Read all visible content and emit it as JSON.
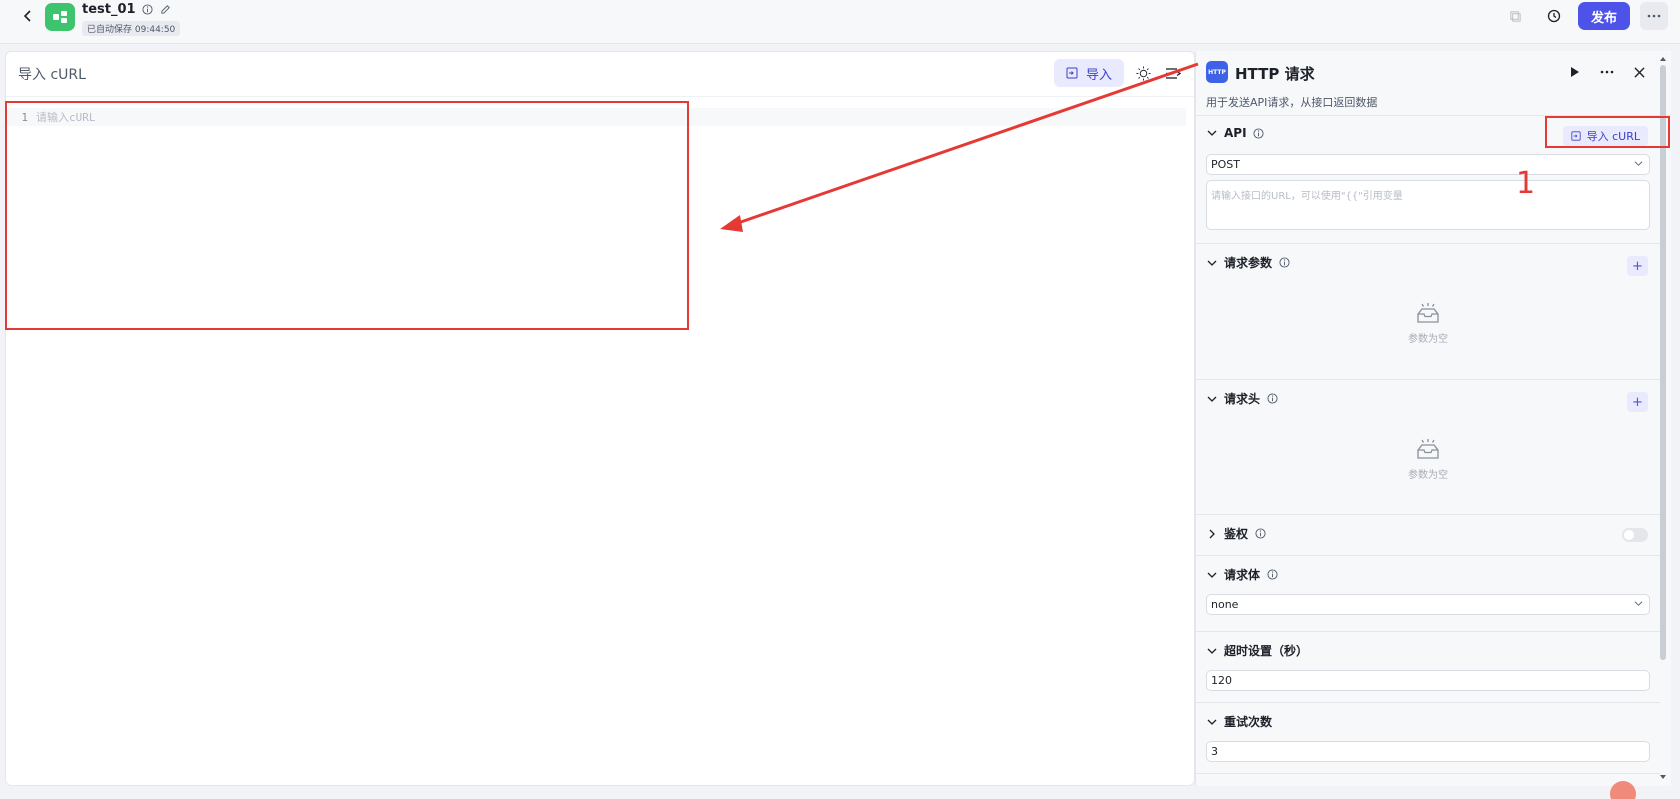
{
  "topbar": {
    "app_title": "test_01",
    "autosave": "已自动保存 09:44:50",
    "publish_label": "发布"
  },
  "editor": {
    "title": "导入 cURL",
    "import_label": "导入",
    "line_number": "1",
    "placeholder": "请输入cURL"
  },
  "http_panel": {
    "logo_text": "HTTP",
    "title": "HTTP 请求",
    "description": "用于发送API请求，从接口返回数据",
    "api": {
      "label": "API",
      "import_curl_label": "导入 cURL",
      "method": "POST",
      "url_placeholder": "请输入接口的URL，可以使用\"{{\"引用变量"
    },
    "params": {
      "label": "请求参数",
      "empty_text": "参数为空"
    },
    "headers": {
      "label": "请求头",
      "empty_text": "参数为空"
    },
    "auth": {
      "label": "鉴权"
    },
    "body": {
      "label": "请求体",
      "value": "none"
    },
    "timeout": {
      "label": "超时设置（秒）",
      "value": "120"
    },
    "retry": {
      "label": "重试次数",
      "value": "3"
    }
  },
  "annotation": {
    "number": "1",
    "color": "#e53935"
  },
  "colors": {
    "accent": "#4d53e8",
    "http_logo": "#3f63e6",
    "app_logo": "#3ec36f"
  }
}
